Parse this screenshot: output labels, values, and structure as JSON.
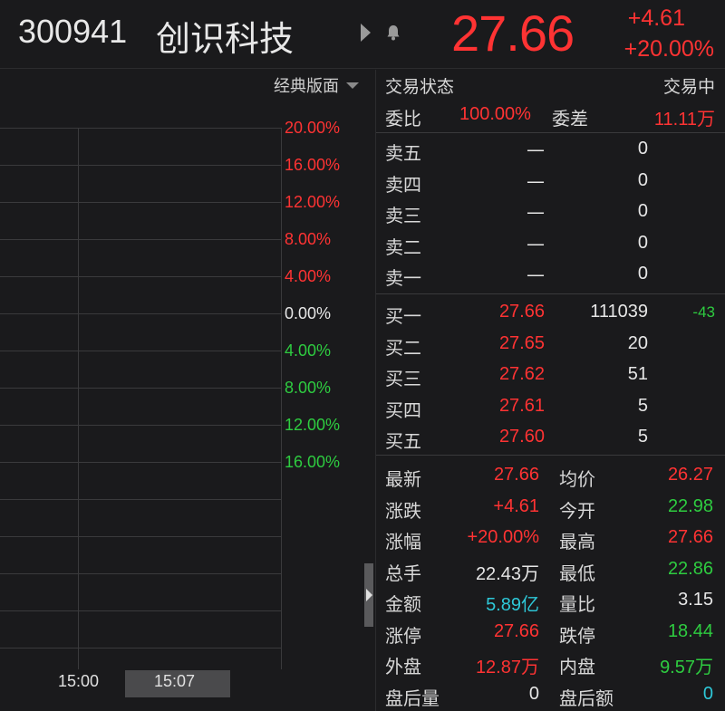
{
  "header": {
    "code": "300941",
    "name": "创识科技",
    "price": "27.66",
    "change": "+4.61",
    "change_pct": "+20.00%"
  },
  "chart": {
    "layout_label": "经典版面",
    "pct_labels": [
      {
        "text": "20.00%",
        "color": "red"
      },
      {
        "text": "16.00%",
        "color": "red"
      },
      {
        "text": "12.00%",
        "color": "red"
      },
      {
        "text": "8.00%",
        "color": "red"
      },
      {
        "text": "4.00%",
        "color": "red"
      },
      {
        "text": "0.00%",
        "color": "white"
      },
      {
        "text": "4.00%",
        "color": "green"
      },
      {
        "text": "8.00%",
        "color": "green"
      },
      {
        "text": "12.00%",
        "color": "green"
      },
      {
        "text": "16.00%",
        "color": "green"
      }
    ],
    "time_labels": [
      "15:00",
      "15:07"
    ]
  },
  "panel": {
    "status_label": "交易状态",
    "status_value": "交易中",
    "ratio_label": "委比",
    "ratio_value": "100.00%",
    "diff_label": "委差",
    "diff_value": "11.11万",
    "asks": [
      {
        "label": "卖五",
        "price": "—",
        "vol": "0"
      },
      {
        "label": "卖四",
        "price": "—",
        "vol": "0"
      },
      {
        "label": "卖三",
        "price": "—",
        "vol": "0"
      },
      {
        "label": "卖二",
        "price": "—",
        "vol": "0"
      },
      {
        "label": "卖一",
        "price": "—",
        "vol": "0"
      }
    ],
    "bids": [
      {
        "label": "买一",
        "price": "27.66",
        "vol": "111039",
        "delta": "-43"
      },
      {
        "label": "买二",
        "price": "27.65",
        "vol": "20",
        "delta": ""
      },
      {
        "label": "买三",
        "price": "27.62",
        "vol": "51",
        "delta": ""
      },
      {
        "label": "买四",
        "price": "27.61",
        "vol": "5",
        "delta": ""
      },
      {
        "label": "买五",
        "price": "27.60",
        "vol": "5",
        "delta": ""
      }
    ],
    "stats": [
      {
        "l1": "最新",
        "v1": "27.66",
        "c1": "red",
        "l2": "均价",
        "v2": "26.27",
        "c2": "red"
      },
      {
        "l1": "涨跌",
        "v1": "+4.61",
        "c1": "red",
        "l2": "今开",
        "v2": "22.98",
        "c2": "green"
      },
      {
        "l1": "涨幅",
        "v1": "+20.00%",
        "c1": "red",
        "l2": "最高",
        "v2": "27.66",
        "c2": "red"
      },
      {
        "l1": "总手",
        "v1": "22.43万",
        "c1": "white",
        "l2": "最低",
        "v2": "22.86",
        "c2": "green"
      },
      {
        "l1": "金额",
        "v1": "5.89亿",
        "c1": "cyan",
        "l2": "量比",
        "v2": "3.15",
        "c2": "white"
      },
      {
        "l1": "涨停",
        "v1": "27.66",
        "c1": "red",
        "l2": "跌停",
        "v2": "18.44",
        "c2": "green"
      },
      {
        "l1": "外盘",
        "v1": "12.87万",
        "c1": "red",
        "l2": "内盘",
        "v2": "9.57万",
        "c2": "green"
      },
      {
        "l1": "盘后量",
        "v1": "0",
        "c1": "white",
        "l2": "盘后额",
        "v2": "0",
        "c2": "cyan"
      }
    ]
  },
  "colors": {
    "up": "#ff3333",
    "down": "#2ecc40",
    "neutral": "#e6e6e6",
    "accent": "#2ec8d8",
    "bg": "#1a1a1c"
  },
  "icons": {
    "play": "play-icon",
    "bell": "bell-icon",
    "dropdown": "chevron-down-icon"
  }
}
